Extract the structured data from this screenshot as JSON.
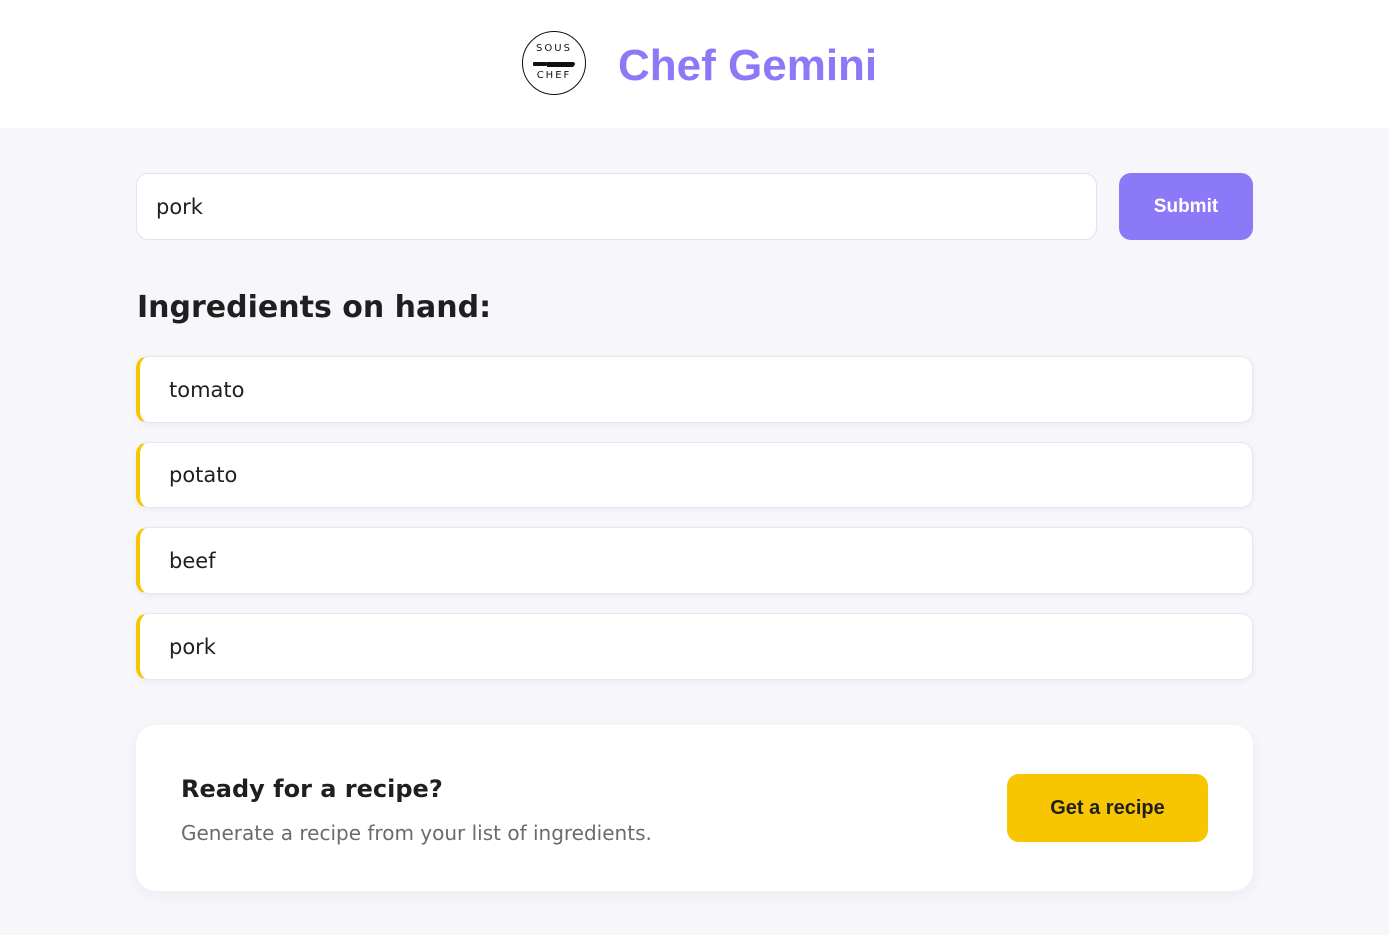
{
  "header": {
    "logo": {
      "icon": "sous-chef-knife-logo",
      "top_text": "SOUS",
      "bottom_text": "CHEF"
    },
    "title": "Chef Gemini"
  },
  "search": {
    "value": "pork",
    "placeholder": "",
    "submit_label": "Submit"
  },
  "ingredients": {
    "heading": "Ingredients on hand:",
    "items": [
      "tomato",
      "potato",
      "beef",
      "pork"
    ]
  },
  "recipe_card": {
    "title": "Ready for a recipe?",
    "description": "Generate a recipe from your list of ingredients.",
    "button_label": "Get a recipe"
  },
  "colors": {
    "accent": "#8b79f7",
    "highlight": "#f7c600",
    "background": "#f6f6fb"
  }
}
